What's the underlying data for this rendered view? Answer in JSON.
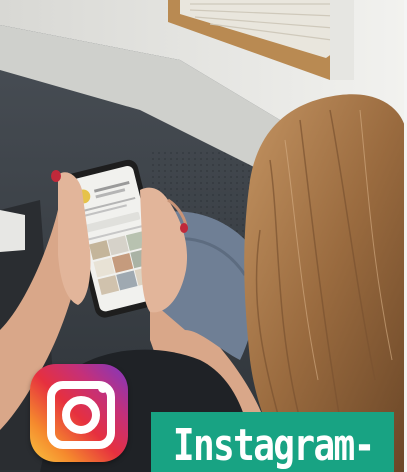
{
  "photo": {
    "scene": "person-holding-smartphone",
    "colors": {
      "wall": "#3b4148",
      "window_frame": "#b98a52",
      "skin": "#e2b59a",
      "hair": "#9a6b3f",
      "phone": "#1e1e1e",
      "screen": "#f1f1ee",
      "jeans": "#6f7f95"
    }
  },
  "logo": {
    "icon": "instagram-icon",
    "gradient": [
      "#f9c440",
      "#e6303f",
      "#7d38c2"
    ]
  },
  "banner": {
    "title": "Instagram-",
    "color": "#18a383"
  }
}
